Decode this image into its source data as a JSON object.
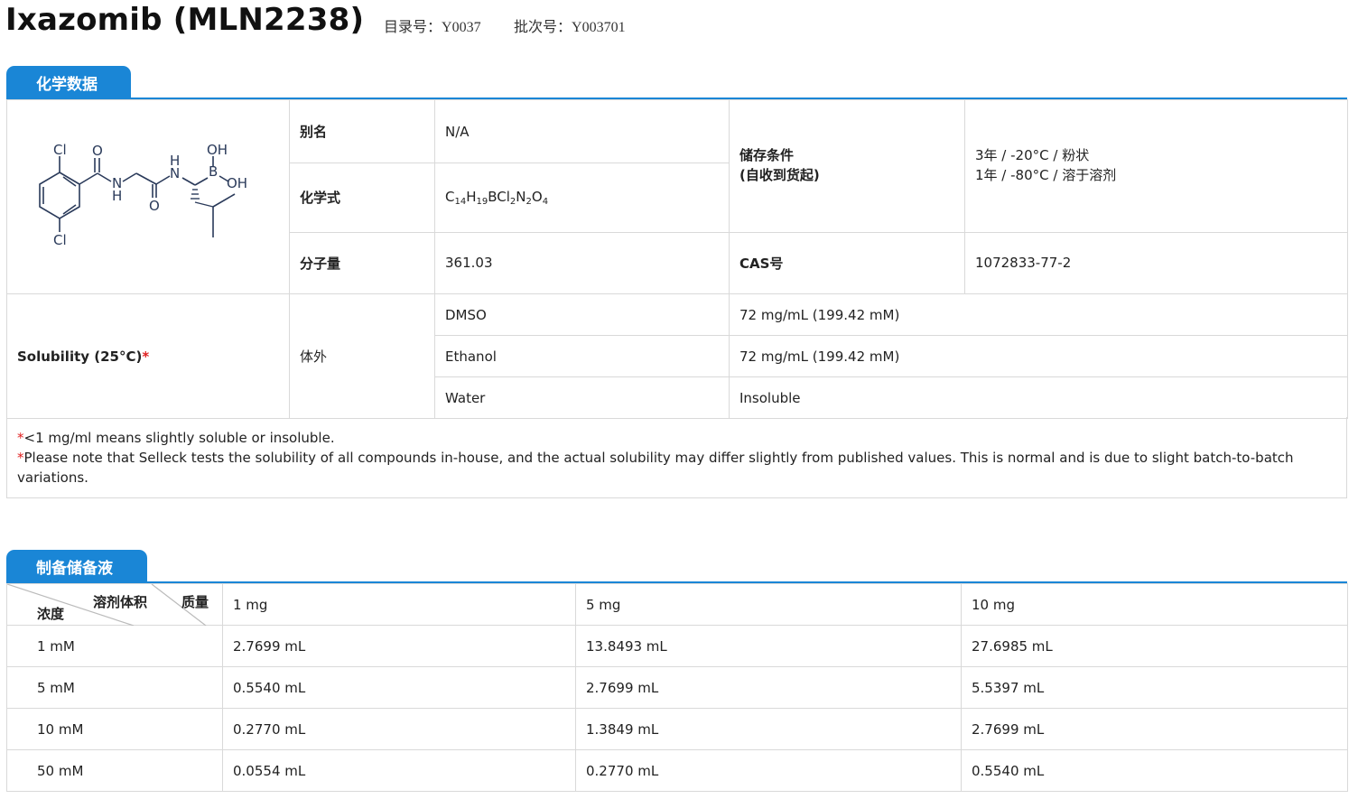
{
  "header": {
    "title": "Ixazomib (MLN2238)",
    "catalog_label": "目录号：",
    "catalog_value": "Y0037",
    "batch_label": "批次号：",
    "batch_value": "Y003701"
  },
  "chem": {
    "section_title": "化学数据",
    "structure_labels": {
      "cl_top": "Cl",
      "cl_bottom": "Cl",
      "o1": "O",
      "nh1_n": "N",
      "nh1_h": "H",
      "o2": "O",
      "nh2_h": "H",
      "nh2_n": "N",
      "b": "B",
      "oh1": "OH",
      "oh2": "OH"
    },
    "alias_label": "别名",
    "alias_value": "N/A",
    "formula_label": "化学式",
    "formula_parts": [
      "C",
      "14",
      "H",
      "19",
      "BCl",
      "2",
      "N",
      "2",
      "O",
      "4"
    ],
    "mw_label": "分子量",
    "mw_value": "361.03",
    "storage_label_1": "储存条件",
    "storage_label_2": "(自收到货起)",
    "storage_value_1": "3年 / -20°C / 粉状",
    "storage_value_2": "1年 / -80°C / 溶于溶剂",
    "cas_label": "CAS号",
    "cas_value": "1072833-77-2",
    "solubility_label": "Solubility (25°C)",
    "solubility_star": "*",
    "invitro_label": "体外",
    "solvents": [
      {
        "name": "DMSO",
        "value": "72 mg/mL (199.42 mM)"
      },
      {
        "name": "Ethanol",
        "value": "72 mg/mL (199.42 mM)"
      },
      {
        "name": "Water",
        "value": "Insoluble"
      }
    ],
    "notes": [
      {
        "star": "*",
        "text": "<1 mg/ml means slightly soluble or insoluble."
      },
      {
        "star": "*",
        "text": "Please note that Selleck tests the solubility of all compounds in-house, and the actual solubility may differ slightly from published values. This is normal and is due to slight batch-to-batch variations."
      }
    ]
  },
  "stock": {
    "section_title": "制备储备液",
    "corner_conc": "浓度",
    "corner_vol": "溶剂体积",
    "corner_mass": "质量",
    "columns": [
      "1 mg",
      "5 mg",
      "10 mg"
    ],
    "rows": [
      {
        "conc": "1 mM",
        "values": [
          "2.7699 mL",
          "13.8493 mL",
          "27.6985 mL"
        ]
      },
      {
        "conc": "5 mM",
        "values": [
          "0.5540 mL",
          "2.7699 mL",
          "5.5397 mL"
        ]
      },
      {
        "conc": "10 mM",
        "values": [
          "0.2770 mL",
          "1.3849 mL",
          "2.7699 mL"
        ]
      },
      {
        "conc": "50 mM",
        "values": [
          "0.0554 mL",
          "0.2770 mL",
          "0.5540 mL"
        ]
      }
    ]
  },
  "colors": {
    "accent": "#1a86d6",
    "star": "#e02020"
  }
}
